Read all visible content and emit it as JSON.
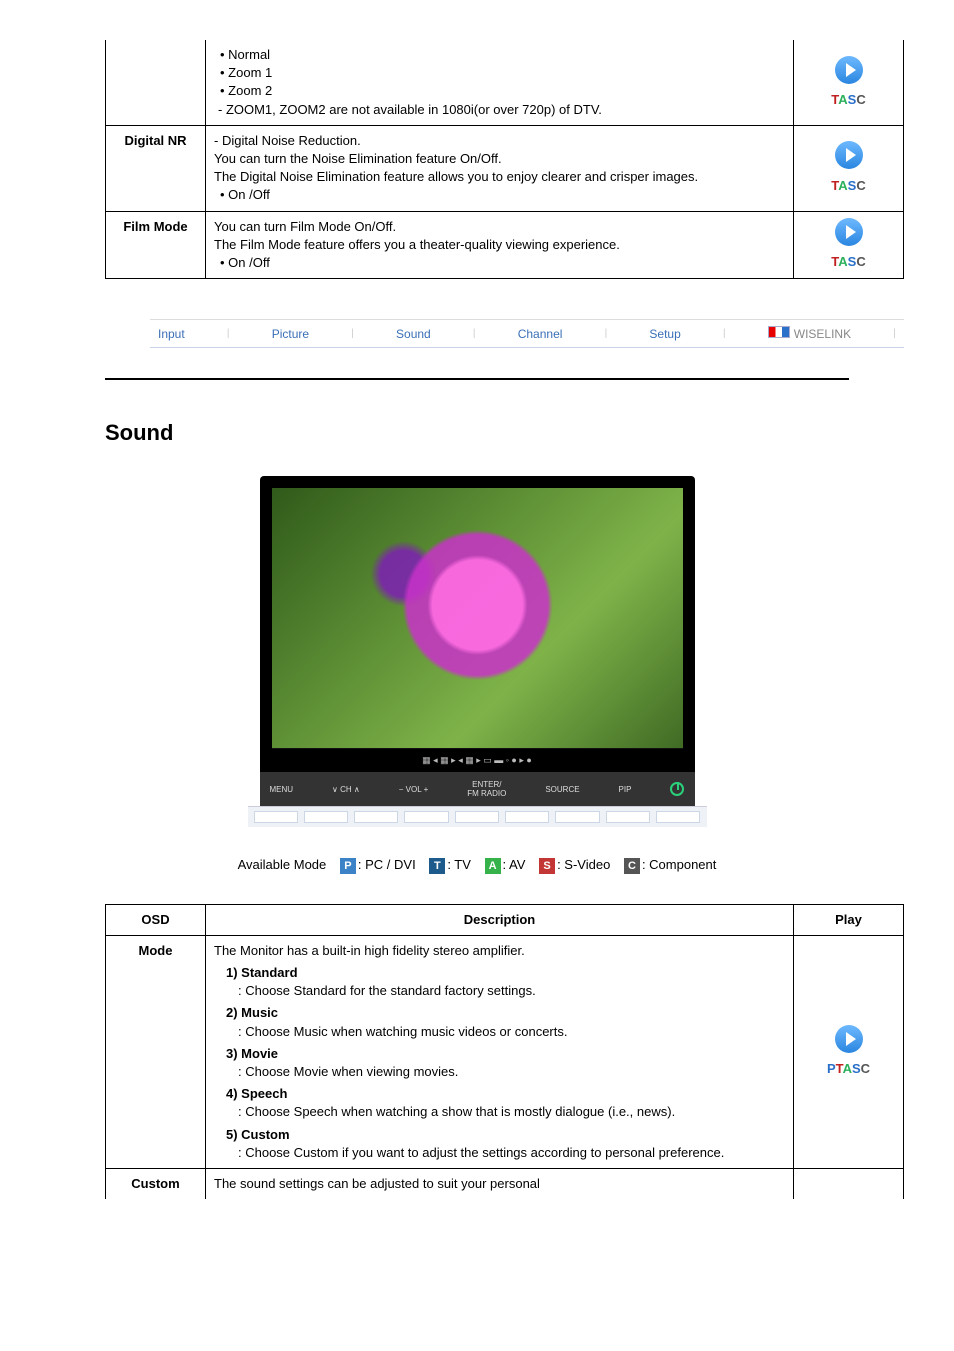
{
  "top_table": {
    "rows": [
      {
        "label_blank": true,
        "bullets": [
          "Normal",
          "Zoom 1",
          "Zoom 2"
        ],
        "note": "- ZOOM1, ZOOM2 are not available in 1080i(or over 720p) of DTV.",
        "badges": "TASC"
      },
      {
        "label": "Digital NR",
        "desc_lines": [
          "- Digital Noise Reduction.",
          "You can turn the Noise Elimination feature On/Off.",
          "The Digital Noise Elimination feature allows you to enjoy clearer and crisper images."
        ],
        "bullets": [
          "On /Off"
        ],
        "badges": "TASC"
      },
      {
        "label": "Film Mode",
        "desc_lines": [
          "You can turn Film Mode On/Off.",
          "The Film Mode feature offers you a theater-quality viewing experience."
        ],
        "bullets": [
          "On /Off"
        ],
        "badges": "TASC"
      }
    ]
  },
  "tabs": [
    "Input",
    "Picture",
    "Sound",
    "Channel",
    "Setup",
    "WISELINK"
  ],
  "section_heading": "Sound",
  "preview_bar_text": "▦   ◂ ▦ ▸    ◂ ▦ ▸  ▭ ▬ ◦   ● ▸   ●",
  "preview_btns": [
    "MENU",
    "∨  CH  ∧",
    "−  VOL  +",
    "ENTER/\nFM RADIO",
    "SOURCE",
    "PIP"
  ],
  "available_mode": {
    "label": "Available Mode",
    "modes": [
      {
        "code": "P",
        "text": ": PC / DVI"
      },
      {
        "code": "T",
        "text": ": TV"
      },
      {
        "code": "A",
        "text": ": AV"
      },
      {
        "code": "S",
        "text": ": S-Video"
      },
      {
        "code": "C",
        "text": ": Component"
      }
    ]
  },
  "sound_table": {
    "headers": {
      "osd": "OSD",
      "desc": "Description",
      "play": "Play"
    },
    "rows": [
      {
        "label": "Mode",
        "intro": "The Monitor has a built-in high fidelity stereo amplifier.",
        "items": [
          {
            "h": "1) Standard",
            "t": ": Choose Standard for the standard factory settings."
          },
          {
            "h": "2) Music",
            "t": ": Choose Music when watching music videos or concerts."
          },
          {
            "h": "3) Movie",
            "t": ": Choose Movie when viewing movies."
          },
          {
            "h": "4) Speech",
            "t": ": Choose Speech when watching a show that is mostly dialogue (i.e., news)."
          },
          {
            "h": "5) Custom",
            "t": ": Choose Custom if you want to adjust the settings according to personal preference."
          }
        ],
        "badges": "PTASC"
      },
      {
        "label": "Custom",
        "intro": "The sound settings can be adjusted to suit your personal"
      }
    ]
  }
}
